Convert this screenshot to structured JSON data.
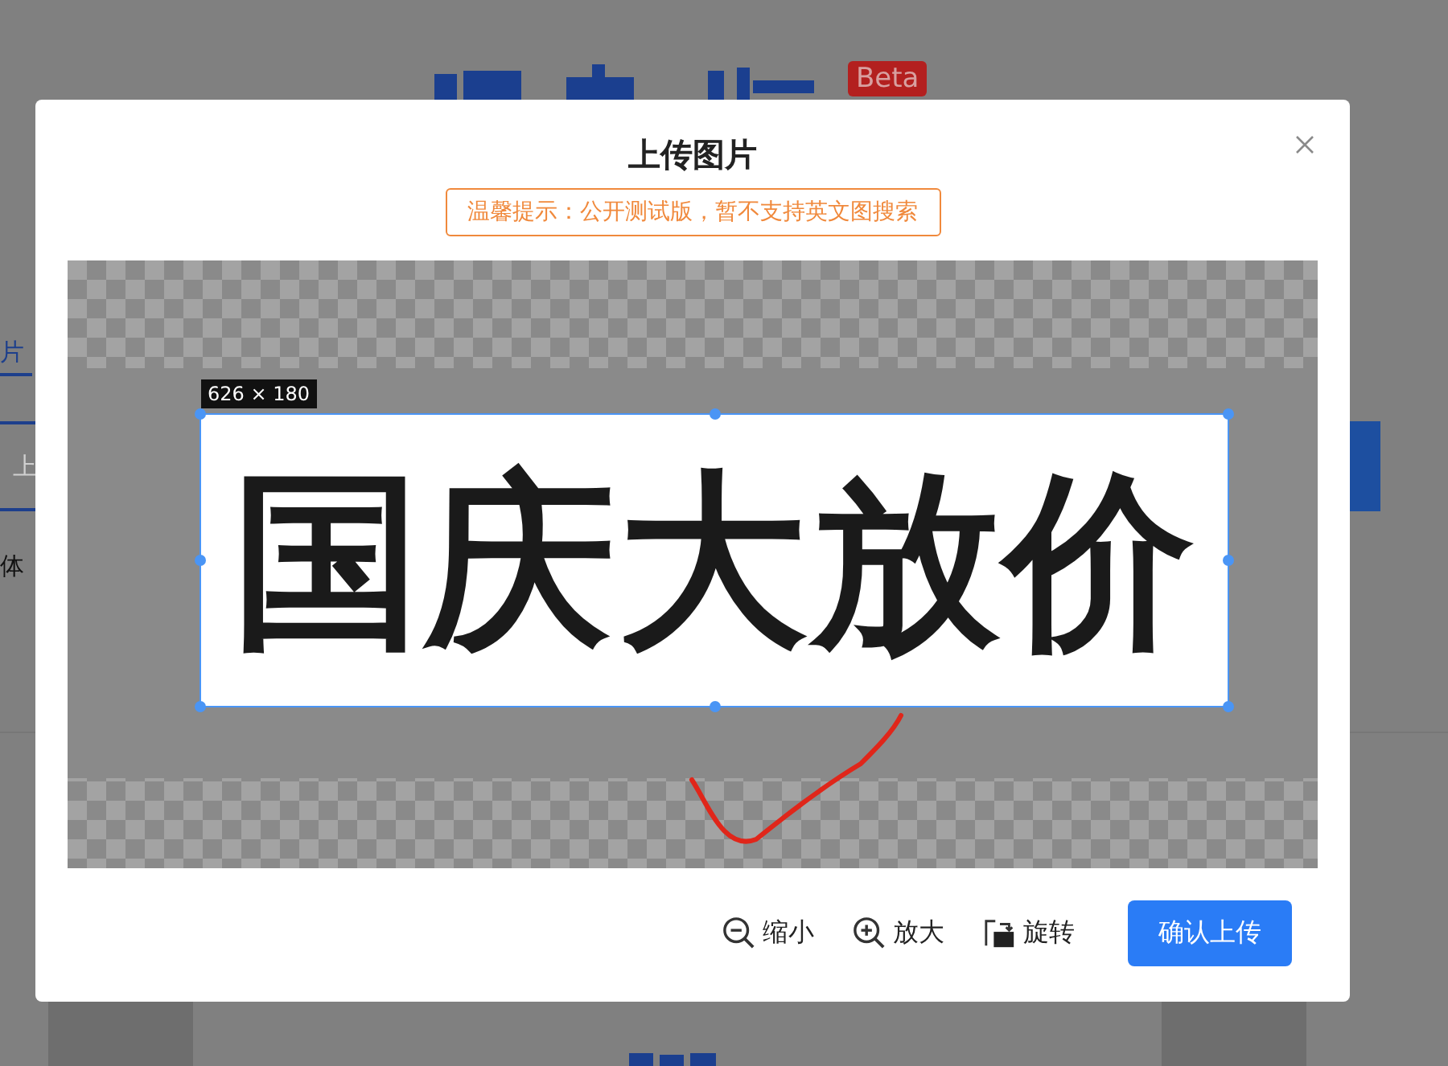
{
  "background": {
    "badge": "Beta",
    "tab": "片",
    "input_placeholder": "上",
    "hint": "体"
  },
  "dialog": {
    "title": "上传图片",
    "notice": "温馨提示：公开测试版，暂不支持英文图搜索",
    "crop": {
      "size": "626 × 180",
      "image_text": "国庆大放价"
    },
    "tools": [
      {
        "kind": "zoom-out",
        "label": "缩小"
      },
      {
        "kind": "zoom-in",
        "label": "放大"
      },
      {
        "kind": "rotate",
        "label": "旋转"
      }
    ],
    "confirm": "确认上传"
  }
}
